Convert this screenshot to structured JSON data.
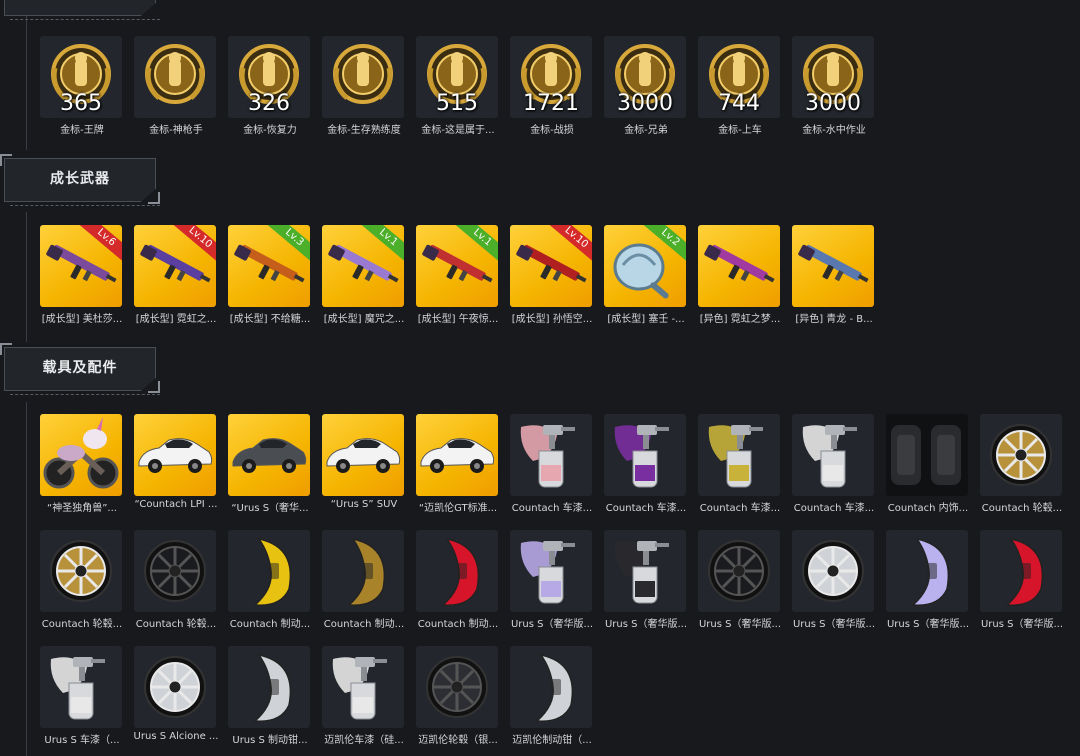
{
  "colors": {
    "background": "#17191d",
    "tile_dark": "#23272d",
    "tile_yellow": "#f5b400",
    "lv_red": "#d42a2a",
    "lv_green": "#4caf2a",
    "gold": "#c99a2e"
  },
  "medals": [
    {
      "number": "365",
      "label": "金标-王牌",
      "icon": "ace-medal-icon"
    },
    {
      "number": "",
      "label": "金标-神枪手",
      "icon": "sharpshooter-medal-icon"
    },
    {
      "number": "326",
      "label": "金标-恢复力",
      "icon": "recovery-medal-icon"
    },
    {
      "number": "",
      "label": "金标-生存熟练度",
      "icon": "survival-medal-icon"
    },
    {
      "number": "515",
      "label": "金标-这是属于...",
      "icon": "soldier-medal-icon"
    },
    {
      "number": "1721",
      "label": "金标-战损",
      "icon": "battle-damage-medal-icon"
    },
    {
      "number": "3000",
      "label": "金标-兄弟",
      "icon": "brothers-medal-icon"
    },
    {
      "number": "744",
      "label": "金标-上车",
      "icon": "car-medal-icon"
    },
    {
      "number": "3000",
      "label": "金标-水中作业",
      "icon": "seal-medal-icon"
    }
  ],
  "sections": {
    "weapons_title": "成长武器",
    "vehicles_title": "载具及配件"
  },
  "weapons": [
    {
      "label": "[成长型] 美杜莎...",
      "lv": "Lv.6",
      "lv_color": "red",
      "icon": "rifle-icon"
    },
    {
      "label": "[成长型] 霓虹之...",
      "lv": "Lv.10",
      "lv_color": "red",
      "icon": "smg-icon"
    },
    {
      "label": "[成长型] 不给糖...",
      "lv": "Lv.3",
      "lv_color": "green",
      "icon": "rifle-icon"
    },
    {
      "label": "[成长型] 魔咒之...",
      "lv": "Lv.1",
      "lv_color": "green",
      "icon": "rifle-icon"
    },
    {
      "label": "[成长型] 午夜惊...",
      "lv": "Lv.1",
      "lv_color": "green",
      "icon": "shotgun-icon"
    },
    {
      "label": "[成长型] 孙悟空...",
      "lv": "Lv.10",
      "lv_color": "red",
      "icon": "shotgun-icon"
    },
    {
      "label": "[成长型] 塞壬 -...",
      "lv": "Lv.2",
      "lv_color": "green",
      "icon": "pan-icon"
    },
    {
      "label": "[异色] 霓虹之梦...",
      "lv": "",
      "lv_color": "",
      "icon": "smg-icon"
    },
    {
      "label": "[异色] 青龙 - B...",
      "lv": "",
      "lv_color": "",
      "icon": "rifle-icon"
    }
  ],
  "vehicles": [
    {
      "label": "“神圣独角兽”...",
      "bg": "yellow",
      "icon": "unicorn-motorbike-icon"
    },
    {
      "label": "“Countach LPI ...",
      "bg": "yellow",
      "icon": "white-car-icon"
    },
    {
      "label": "“Urus S（奢华...",
      "bg": "yellow",
      "icon": "dark-car-icon"
    },
    {
      "label": "“Urus S” SUV",
      "bg": "yellow",
      "icon": "white-suv-icon"
    },
    {
      "label": "“迈凯伦GT标准...",
      "bg": "yellow",
      "icon": "white-car-icon"
    },
    {
      "label": "Countach 车漆...",
      "bg": "dark",
      "icon": "paint-sprayer-pink-icon"
    },
    {
      "label": "Countach 车漆...",
      "bg": "dark",
      "icon": "paint-sprayer-purple-icon"
    },
    {
      "label": "Countach 车漆...",
      "bg": "dark",
      "icon": "paint-sprayer-gold-icon"
    },
    {
      "label": "Countach 车漆...",
      "bg": "dark",
      "icon": "paint-sprayer-white-icon"
    },
    {
      "label": "Countach 内饰...",
      "bg": "black",
      "icon": "car-seat-icon"
    },
    {
      "label": "Countach 轮毂...",
      "bg": "dark",
      "icon": "wheel-gold-icon"
    },
    {
      "label": "Countach 轮毂...",
      "bg": "dark",
      "icon": "wheel-gold-icon"
    },
    {
      "label": "Countach 轮毂...",
      "bg": "dark",
      "icon": "wheel-black-icon"
    },
    {
      "label": "Countach 制动...",
      "bg": "dark",
      "icon": "caliper-yellow-icon"
    },
    {
      "label": "Countach 制动...",
      "bg": "dark",
      "icon": "caliper-gold-icon"
    },
    {
      "label": "Countach 制动...",
      "bg": "dark",
      "icon": "caliper-red-icon"
    },
    {
      "label": "Urus S（奢华版...",
      "bg": "dark",
      "icon": "paint-sprayer-lilac-icon"
    },
    {
      "label": "Urus S（奢华版...",
      "bg": "dark",
      "icon": "paint-sprayer-black-icon"
    },
    {
      "label": "Urus S（奢华版...",
      "bg": "dark",
      "icon": "wheel-black-icon"
    },
    {
      "label": "Urus S（奢华版...",
      "bg": "dark",
      "icon": "wheel-silver-icon"
    },
    {
      "label": "Urus S（奢华版...",
      "bg": "dark",
      "icon": "caliper-lilac-icon"
    },
    {
      "label": "Urus S（奢华版...",
      "bg": "dark",
      "icon": "caliper-red-icon"
    },
    {
      "label": "Urus S 车漆（...",
      "bg": "dark",
      "icon": "paint-sprayer-white-icon"
    },
    {
      "label": "Urus S Alcione ...",
      "bg": "dark",
      "icon": "wheel-silver-icon"
    },
    {
      "label": "Urus S 制动钳...",
      "bg": "dark",
      "icon": "caliper-silver-icon"
    },
    {
      "label": "迈凯伦车漆（硅...",
      "bg": "dark",
      "icon": "paint-sprayer-white-icon"
    },
    {
      "label": "迈凯伦轮毂（银...",
      "bg": "dark",
      "icon": "wheel-dark-icon"
    },
    {
      "label": "迈凯伦制动钳（...",
      "bg": "dark",
      "icon": "caliper-silver-icon"
    }
  ]
}
